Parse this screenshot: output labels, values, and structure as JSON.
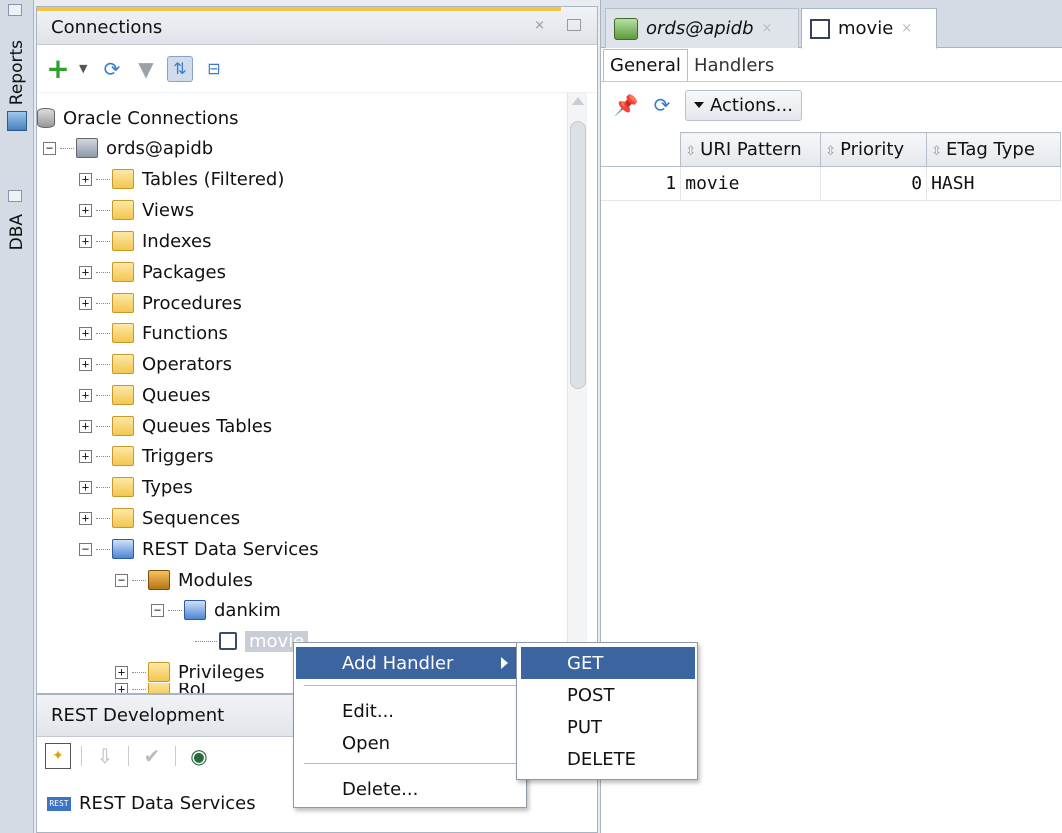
{
  "side_dock": {
    "tabs": [
      {
        "label": "Reports"
      },
      {
        "label": "DBA"
      }
    ]
  },
  "connections_panel": {
    "title": "Connections",
    "close_glyph": "×",
    "toolbar": {
      "buttons": [
        "add-connection-icon",
        "refresh-icon",
        "filter-icon",
        "schema-browser-icon",
        "collapse-icon"
      ]
    },
    "tree": {
      "root": "Oracle Connections",
      "connection": "ords@apidb",
      "nodes": [
        {
          "label": "Tables (Filtered)",
          "expander": "+"
        },
        {
          "label": "Views",
          "expander": "+"
        },
        {
          "label": "Indexes",
          "expander": "+"
        },
        {
          "label": "Packages",
          "expander": "+"
        },
        {
          "label": "Procedures",
          "expander": "+"
        },
        {
          "label": "Functions",
          "expander": "+"
        },
        {
          "label": "Operators",
          "expander": "+"
        },
        {
          "label": "Queues",
          "expander": "+"
        },
        {
          "label": "Queues Tables",
          "expander": "+"
        },
        {
          "label": "Triggers",
          "expander": "+"
        },
        {
          "label": "Types",
          "expander": "+"
        },
        {
          "label": "Sequences",
          "expander": "+"
        },
        {
          "label": "REST Data Services",
          "expander": "−"
        }
      ],
      "modules_label": "Modules",
      "module_name": "dankim",
      "template_name": "movie",
      "privileges_label": "Privileges",
      "partial_label": "Rol"
    }
  },
  "rest_panel": {
    "title": "REST Development",
    "item_badge": "REST",
    "item_label": "REST Data Services"
  },
  "editor": {
    "doc_tabs": [
      {
        "label": "ords@apidb",
        "close": "×"
      },
      {
        "label": "movie",
        "close": "×"
      }
    ],
    "sub_tabs": [
      "General",
      "Handlers"
    ],
    "actions_label": "Actions...",
    "table": {
      "headers": [
        "URI Pattern",
        "Priority",
        "ETag Type"
      ],
      "rows": [
        {
          "num": "1",
          "uri": "movie",
          "priority": "0",
          "etag": "HASH"
        }
      ]
    }
  },
  "context_menu": {
    "items": {
      "add_handler": "Add Handler",
      "edit": "Edit...",
      "open": "Open",
      "delete": "Delete..."
    },
    "submenu": [
      "GET",
      "POST",
      "PUT",
      "DELETE"
    ],
    "highlight_color": "#3c64a0"
  }
}
